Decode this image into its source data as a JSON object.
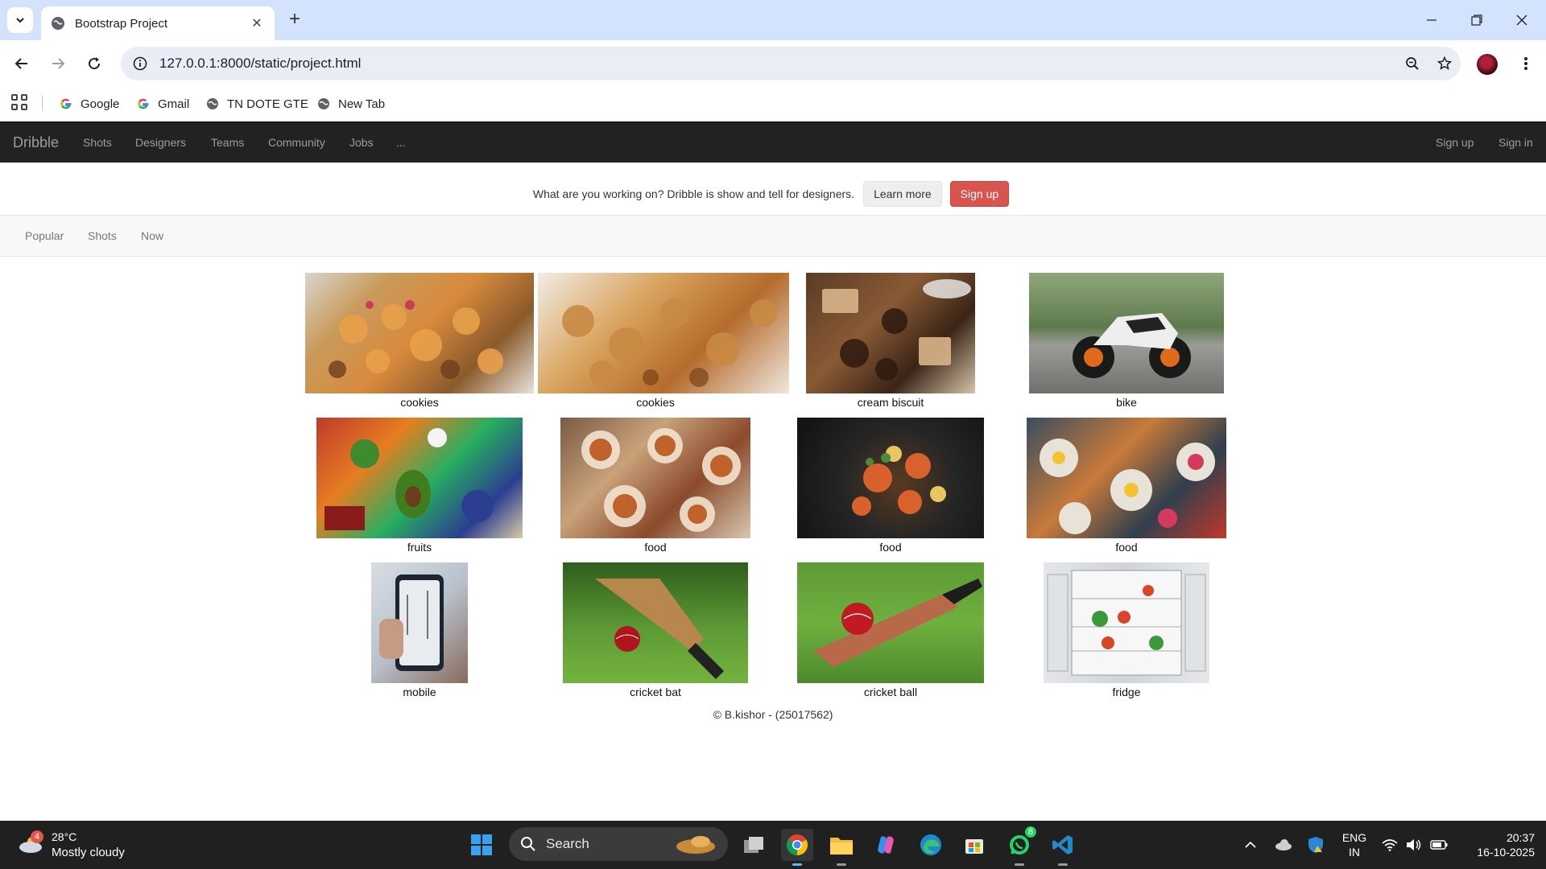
{
  "browser": {
    "tab_title": "Bootstrap Project",
    "url": "127.0.0.1:8000/static/project.html",
    "bookmarks": [
      {
        "label": "Google",
        "icon": "google-icon"
      },
      {
        "label": "Gmail",
        "icon": "google-icon"
      },
      {
        "label": "TN DOTE GTE",
        "icon": "globe-icon"
      },
      {
        "label": "New Tab",
        "icon": "globe-icon"
      }
    ]
  },
  "navbar": {
    "brand": "Dribble",
    "links": [
      "Shots",
      "Designers",
      "Teams",
      "Community",
      "Jobs",
      "..."
    ],
    "right_links": [
      "Sign up",
      "Sign in"
    ]
  },
  "jumbotron": {
    "text": "What are you working on? Dribble is show and tell for designers.",
    "learn_more": "Learn more",
    "sign_up": "Sign up"
  },
  "subnav": {
    "links": [
      "Popular",
      "Shots",
      "Now"
    ]
  },
  "gallery": {
    "items": [
      {
        "caption": "cookies"
      },
      {
        "caption": "cookies"
      },
      {
        "caption": "cream biscuit"
      },
      {
        "caption": "bike"
      },
      {
        "caption": "fruits"
      },
      {
        "caption": "food"
      },
      {
        "caption": "food"
      },
      {
        "caption": "food"
      },
      {
        "caption": "mobile"
      },
      {
        "caption": "cricket bat"
      },
      {
        "caption": "cricket ball"
      },
      {
        "caption": "fridge"
      }
    ]
  },
  "footer": {
    "text": "© B.kishor - (25017562)"
  },
  "taskbar": {
    "weather_temp": "28°C",
    "weather_cond": "Mostly cloudy",
    "weather_badge": "4",
    "search_label": "Search",
    "whatsapp_badge": "8",
    "lang_line1": "ENG",
    "lang_line2": "IN",
    "time": "20:37",
    "date": "16-10-2025"
  },
  "colors": {
    "navbar_bg": "#222222",
    "danger": "#d9534f",
    "tabbar": "#d3e3fd",
    "taskbar": "#202020"
  }
}
